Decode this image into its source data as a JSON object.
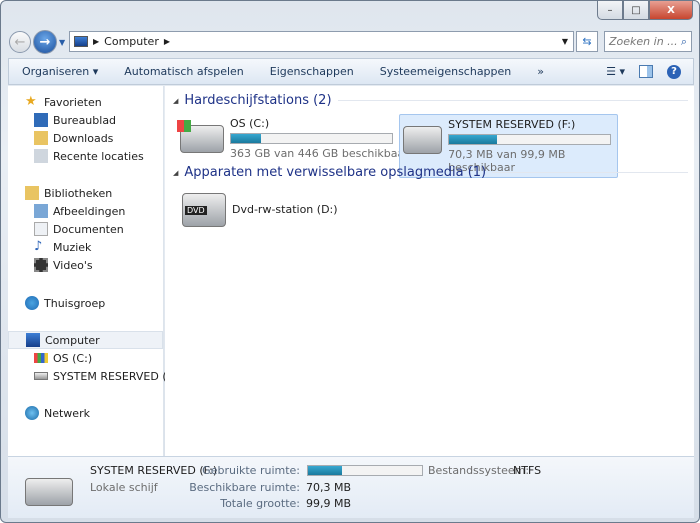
{
  "window": {
    "minimize": "–",
    "maximize": "□",
    "close": "X"
  },
  "address": {
    "path": [
      "Computer"
    ],
    "search_placeholder": "Zoeken in ..."
  },
  "toolbar": {
    "organize": "Organiseren ▾",
    "autoplay": "Automatisch afspelen",
    "properties": "Eigenschappen",
    "system_properties": "Systeemeigenschappen",
    "more": "»"
  },
  "sidebar": {
    "favorites": {
      "label": "Favorieten",
      "items": [
        "Bureaublad",
        "Downloads",
        "Recente locaties"
      ]
    },
    "libraries": {
      "label": "Bibliotheken",
      "items": [
        "Afbeeldingen",
        "Documenten",
        "Muziek",
        "Video's"
      ]
    },
    "homegroup": "Thuisgroep",
    "computer": {
      "label": "Computer",
      "items": [
        "OS (C:)",
        "SYSTEM RESERVED (F:)"
      ]
    },
    "network": "Netwerk"
  },
  "groups": [
    {
      "title": "Hardeschijfstations (2)",
      "drives": [
        {
          "name": "OS (C:)",
          "info": "363 GB van 446 GB beschikbaar",
          "used_fraction": 0.186
        },
        {
          "name": "SYSTEM RESERVED (F:)",
          "info": "70,3 MB van 99,9 MB beschikbaar",
          "used_fraction": 0.296,
          "selected": true
        }
      ]
    },
    {
      "title": "Apparaten met verwisselbare opslagmedia (1)",
      "drives": [
        {
          "name": "Dvd-rw-station (D:)",
          "badge": "DVD"
        }
      ]
    }
  ],
  "details": {
    "name": "SYSTEM RESERVED (F:)",
    "type": "Lokale schijf",
    "used_label": "Gebruikte ruimte:",
    "used_fraction": 0.296,
    "free_label": "Beschikbare ruimte:",
    "free_value": "70,3 MB",
    "total_label": "Totale grootte:",
    "total_value": "99,9 MB",
    "fs_label": "Bestandssysteem:",
    "fs_value": "NTFS"
  }
}
